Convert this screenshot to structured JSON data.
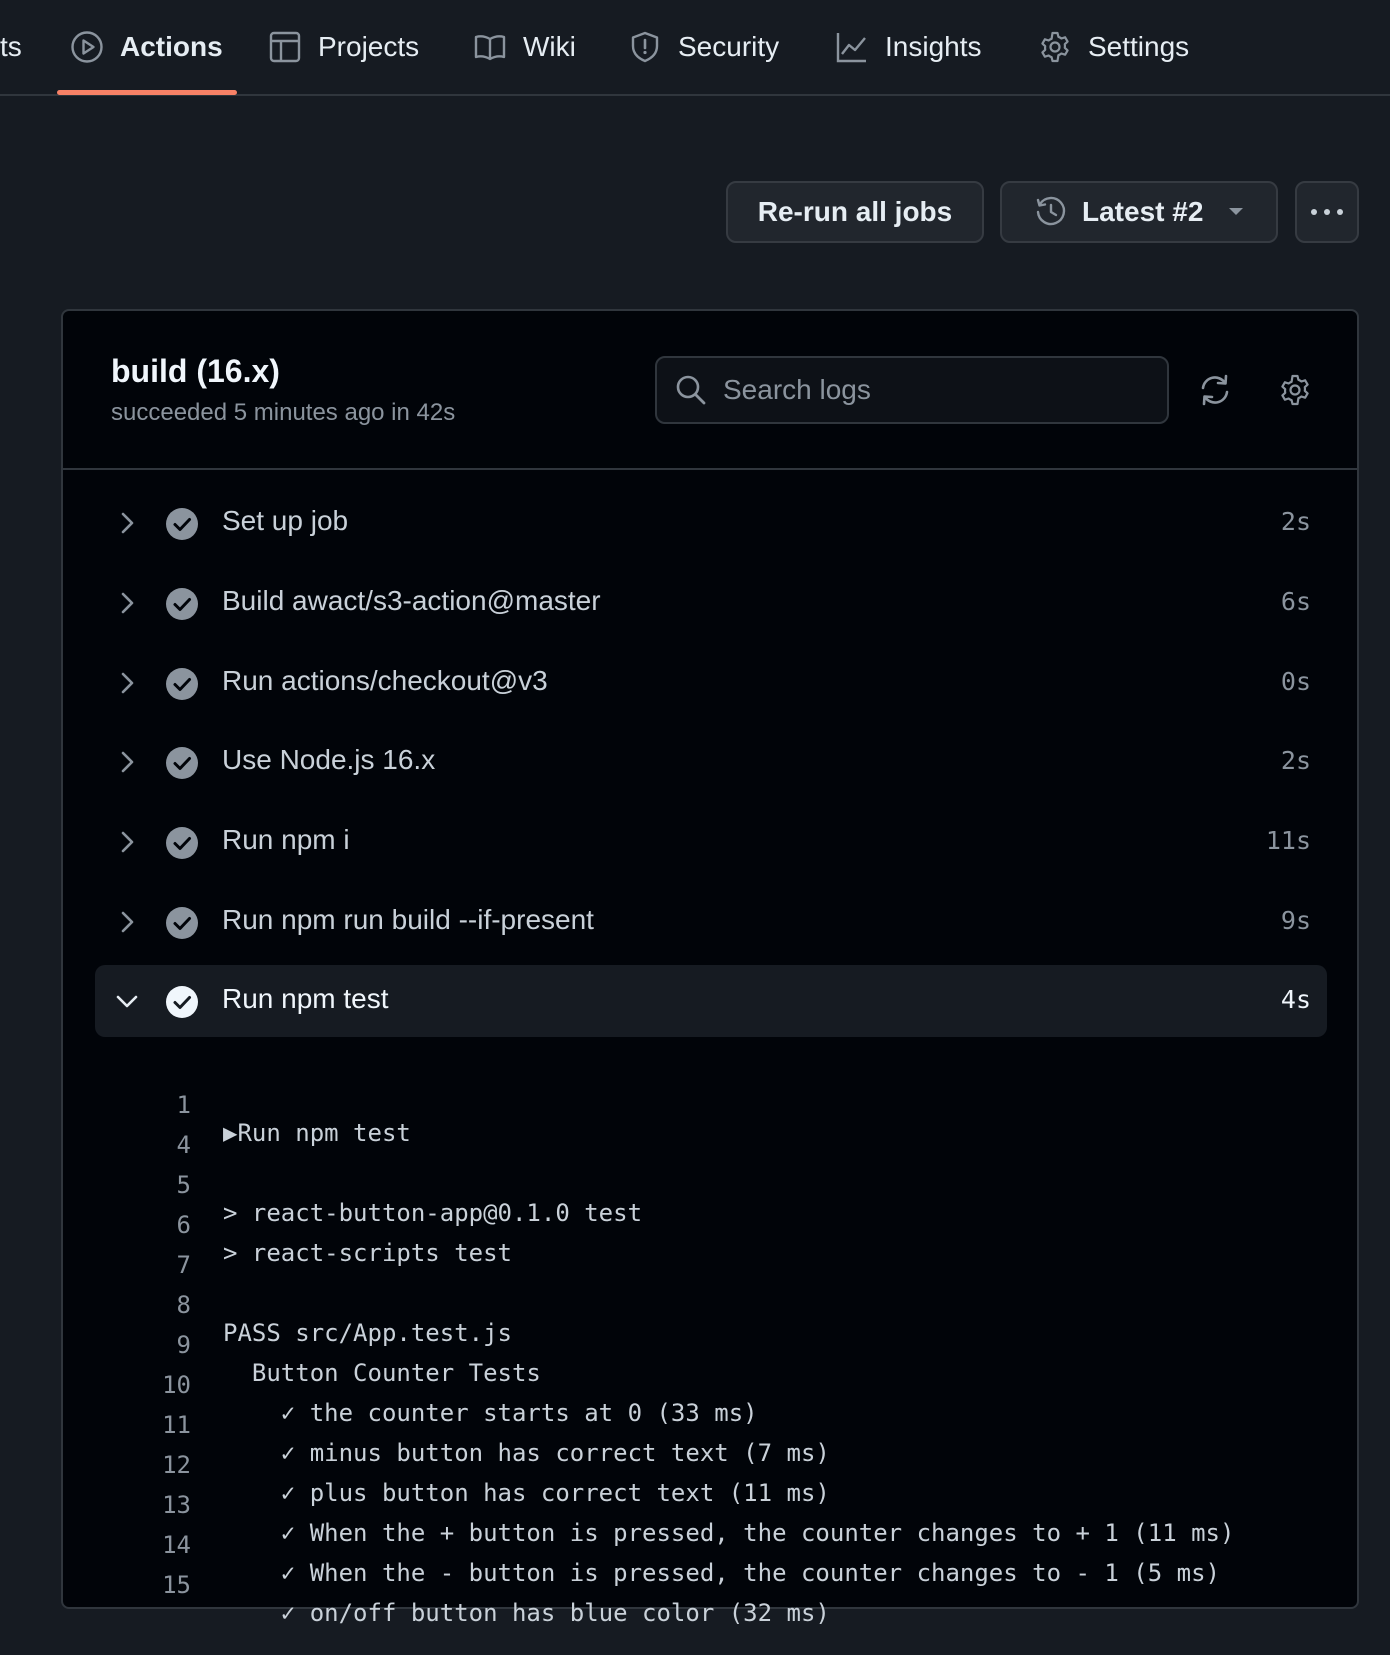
{
  "nav": {
    "partial_tab": "ts",
    "tabs": [
      {
        "label": "Actions",
        "icon": "play-icon",
        "active": true
      },
      {
        "label": "Projects",
        "icon": "table-icon",
        "active": false
      },
      {
        "label": "Wiki",
        "icon": "book-icon",
        "active": false
      },
      {
        "label": "Security",
        "icon": "shield-icon",
        "active": false
      },
      {
        "label": "Insights",
        "icon": "graph-icon",
        "active": false
      },
      {
        "label": "Settings",
        "icon": "gear-icon",
        "active": false
      }
    ]
  },
  "toolbar": {
    "rerun_label": "Re-run all jobs",
    "latest_label": "Latest #2"
  },
  "job": {
    "title": "build (16.x)",
    "subtitle": "succeeded 5 minutes ago in 42s",
    "search_placeholder": "Search logs"
  },
  "steps": [
    {
      "name": "Set up job",
      "duration": "2s",
      "expanded": false
    },
    {
      "name": "Build awact/s3-action@master",
      "duration": "6s",
      "expanded": false
    },
    {
      "name": "Run actions/checkout@v3",
      "duration": "0s",
      "expanded": false
    },
    {
      "name": "Use Node.js 16.x",
      "duration": "2s",
      "expanded": false
    },
    {
      "name": "Run npm i",
      "duration": "11s",
      "expanded": false
    },
    {
      "name": "Run npm run build --if-present",
      "duration": "9s",
      "expanded": false
    },
    {
      "name": "Run npm test",
      "duration": "4s",
      "expanded": true
    }
  ],
  "log_lines": [
    {
      "num": "1",
      "text": "▶Run npm test"
    },
    {
      "num": "4",
      "text": ""
    },
    {
      "num": "5",
      "text": "> react-button-app@0.1.0 test"
    },
    {
      "num": "6",
      "text": "> react-scripts test"
    },
    {
      "num": "7",
      "text": ""
    },
    {
      "num": "8",
      "text": "PASS src/App.test.js"
    },
    {
      "num": "9",
      "text": "  Button Counter Tests"
    },
    {
      "num": "10",
      "text": "    ✓ the counter starts at 0 (33 ms)"
    },
    {
      "num": "11",
      "text": "    ✓ minus button has correct text (7 ms)"
    },
    {
      "num": "12",
      "text": "    ✓ plus button has correct text (11 ms)"
    },
    {
      "num": "13",
      "text": "    ✓ When the + button is pressed, the counter changes to + 1 (11 ms)"
    },
    {
      "num": "14",
      "text": "    ✓ When the - button is pressed, the counter changes to - 1 (5 ms)"
    },
    {
      "num": "15",
      "text": "    ✓ on/off button has blue color (32 ms)"
    }
  ],
  "colors": {
    "accent_underline": "#f78166",
    "background": "#161b22",
    "log_background": "#010409"
  }
}
